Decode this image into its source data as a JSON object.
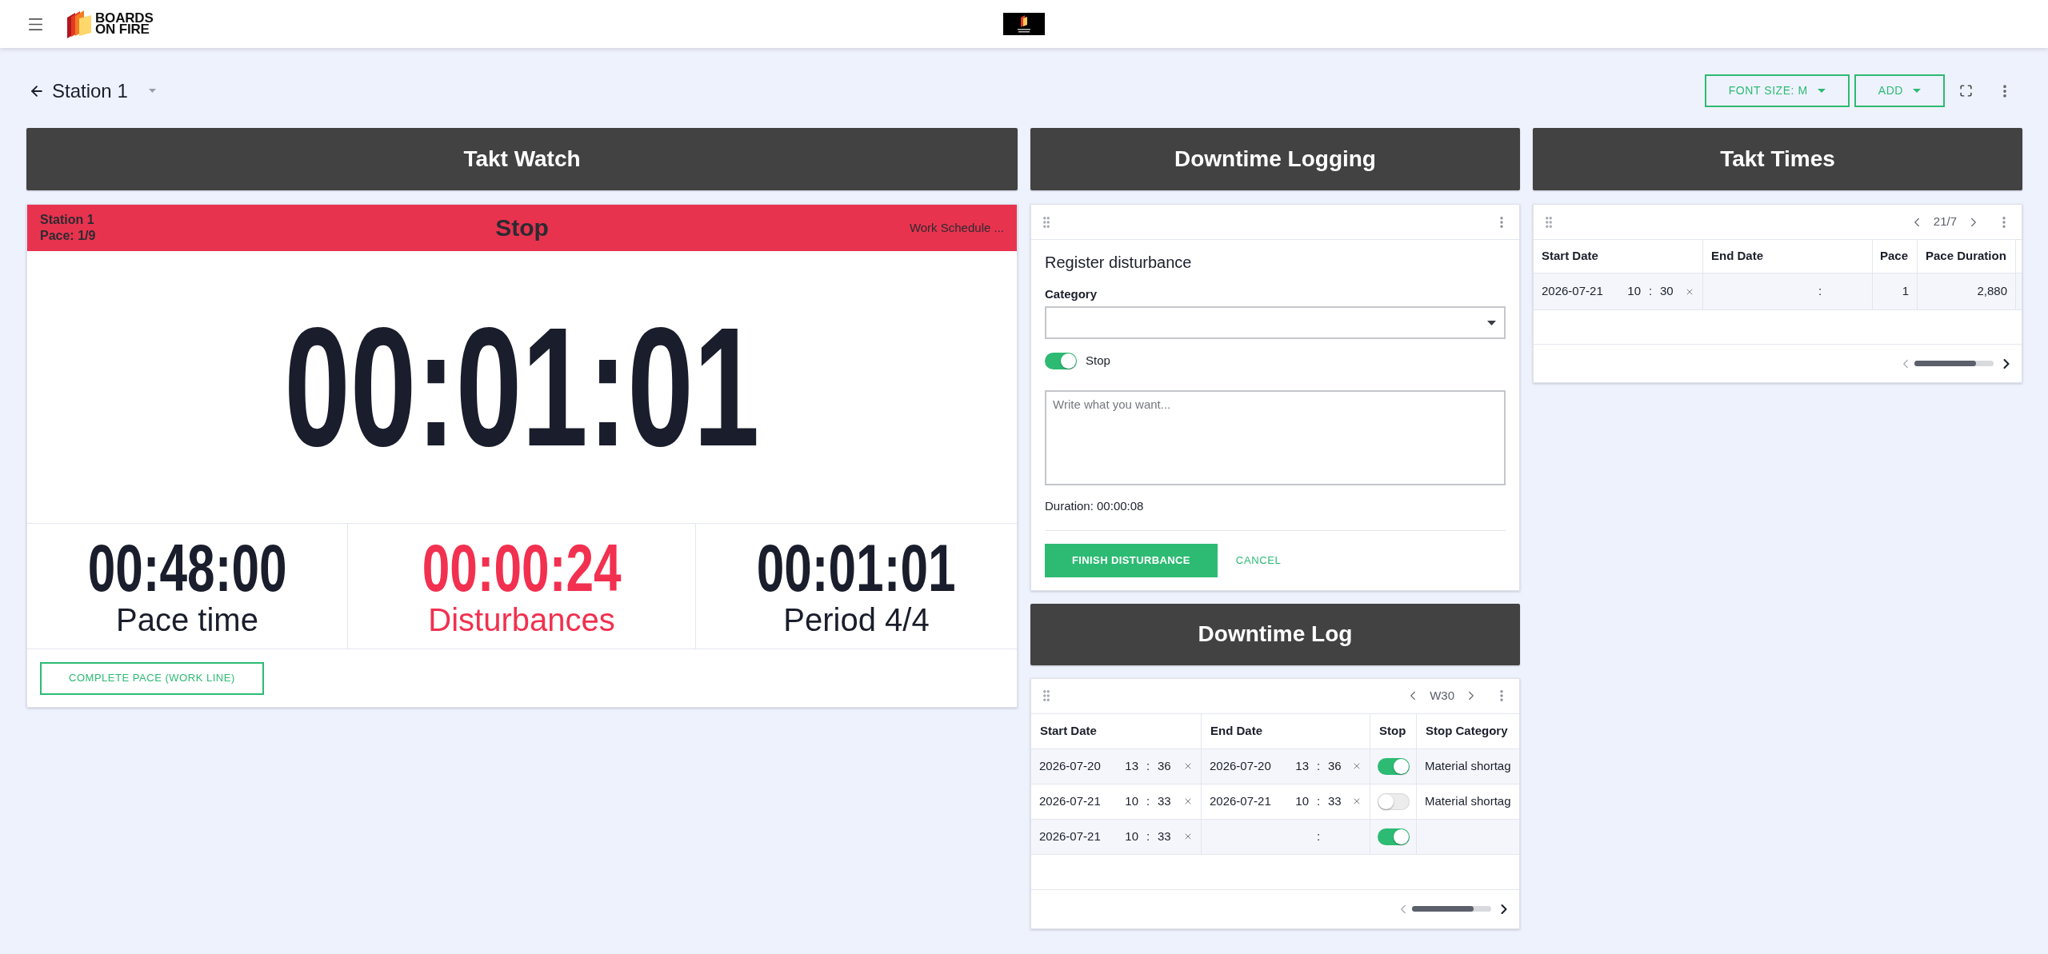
{
  "top_bar": {
    "logo": [
      "BOARDS",
      "ON FIRE"
    ]
  },
  "page_header": {
    "title": "Station 1",
    "buttons": [
      {
        "label": "FONT SIZE: M"
      },
      {
        "label": "ADD"
      }
    ]
  },
  "takt_watch": {
    "title": "Takt Watch",
    "status_bar": {
      "station": "Station 1",
      "pace": "Pace: 1/9",
      "status": "Stop",
      "schedule": "Work Schedule ..."
    },
    "timer": "00:01:01",
    "stats": [
      {
        "value": "00:48:00",
        "label": "Pace time",
        "alert": false
      },
      {
        "value": "00:00:24",
        "label": "Disturbances",
        "alert": true
      },
      {
        "value": "00:01:01",
        "label": "Period 4/4",
        "alert": false
      }
    ],
    "button": "COMPLETE PACE (WORK LINE)"
  },
  "downtime_logging": {
    "title": "Downtime Logging",
    "form_title": "Register disturbance",
    "category_label": "Category",
    "stop_toggle": {
      "label": "Stop",
      "on": true
    },
    "notes": {
      "placeholder": "Write what you want..."
    },
    "duration": "Duration: 00:00:08",
    "buttons": [
      {
        "label": "FINISH DISTURBANCE",
        "kind": "primary"
      },
      {
        "label": "CANCEL",
        "kind": "text"
      }
    ]
  },
  "takt_times": {
    "title": "Takt Times",
    "pager": "21/7",
    "columns": [
      "Start Date",
      "End Date",
      "Pace",
      "Pace Duration"
    ],
    "rows": [
      {
        "start_date": {
          "date": "2026-07-21",
          "hour": "10",
          "separator": ":",
          "minute": "30"
        },
        "end_date": {
          "separator": ":"
        },
        "pace": "1",
        "pace_duration": "2,880"
      }
    ]
  },
  "downtime_log": {
    "title": "Downtime Log",
    "pager": "W30",
    "columns": [
      "Start Date",
      "End Date",
      "Stop",
      "Stop Category"
    ],
    "rows": [
      {
        "start_date": {
          "date": "2026-07-20",
          "hour": "13",
          "separator": ":",
          "minute": "36"
        },
        "end_date": {
          "date": "2026-07-20",
          "hour": "13",
          "separator": ":",
          "minute": "36"
        },
        "stop": true,
        "stop_category": "Material shortag"
      },
      {
        "start_date": {
          "date": "2026-07-21",
          "hour": "10",
          "separator": ":",
          "minute": "33"
        },
        "end_date": {
          "date": "2026-07-21",
          "hour": "10",
          "separator": ":",
          "minute": "33"
        },
        "stop": false,
        "stop_category": "Material shortag"
      },
      {
        "start_date": {
          "date": "2026-07-21",
          "hour": "10",
          "separator": ":",
          "minute": "33"
        },
        "end_date": {
          "separator": ":"
        },
        "stop": true
      }
    ]
  }
}
